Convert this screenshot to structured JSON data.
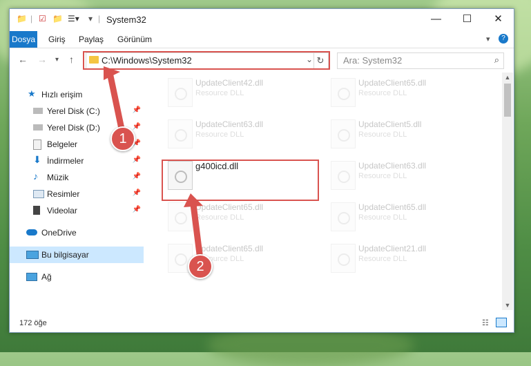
{
  "window": {
    "title": "System32",
    "tabs": [
      "Dosya",
      "Giriş",
      "Paylaş",
      "Görünüm"
    ],
    "controls": {
      "minimize": "—",
      "maximize": "☐",
      "close": "✕"
    },
    "help": "?"
  },
  "address": {
    "path": "C:\\Windows\\System32",
    "search_placeholder": "Ara: System32"
  },
  "nav": {
    "quick_access": "Hızlı erişim",
    "items": [
      {
        "label": "Yerel Disk (C:)",
        "icon": "drive-icon",
        "pinned": true
      },
      {
        "label": "Yerel Disk (D:)",
        "icon": "drive-icon",
        "pinned": true
      },
      {
        "label": "Belgeler",
        "icon": "documents-icon",
        "pinned": true
      },
      {
        "label": "İndirmeler",
        "icon": "download-icon",
        "pinned": true
      },
      {
        "label": "Müzik",
        "icon": "music-icon",
        "pinned": true
      },
      {
        "label": "Resimler",
        "icon": "pictures-icon",
        "pinned": true
      },
      {
        "label": "Videolar",
        "icon": "videos-icon",
        "pinned": true
      }
    ],
    "onedrive": "OneDrive",
    "this_pc": "Bu bilgisayar",
    "network": "Ağ"
  },
  "files": [
    {
      "name": "UpdateClient42.dll",
      "type": "Resource DLL",
      "faded": true
    },
    {
      "name": "UpdateClient65.dll",
      "type": "Resource DLL",
      "faded": true
    },
    {
      "name": "UpdateClient63.dll",
      "type": "Resource DLL",
      "faded": true
    },
    {
      "name": "UpdateClient5.dll",
      "type": "Resource DLL",
      "faded": true
    },
    {
      "name": "g400icd.dll",
      "type": "",
      "faded": false
    },
    {
      "name": "UpdateClient63.dll",
      "type": "Resource DLL",
      "faded": true
    },
    {
      "name": "UpdateClient65.dll",
      "type": "Resource DLL",
      "faded": true
    },
    {
      "name": "UpdateClient65.dll",
      "type": "Resource DLL",
      "faded": true
    },
    {
      "name": "UpdateClient65.dll",
      "type": "Resource DLL",
      "faded": true
    },
    {
      "name": "UpdateClient21.dll",
      "type": "Resource DLL",
      "faded": true
    }
  ],
  "status": {
    "count": "172 öğe"
  },
  "annotations": {
    "step1": "1",
    "step2": "2",
    "color": "#d9534f"
  }
}
